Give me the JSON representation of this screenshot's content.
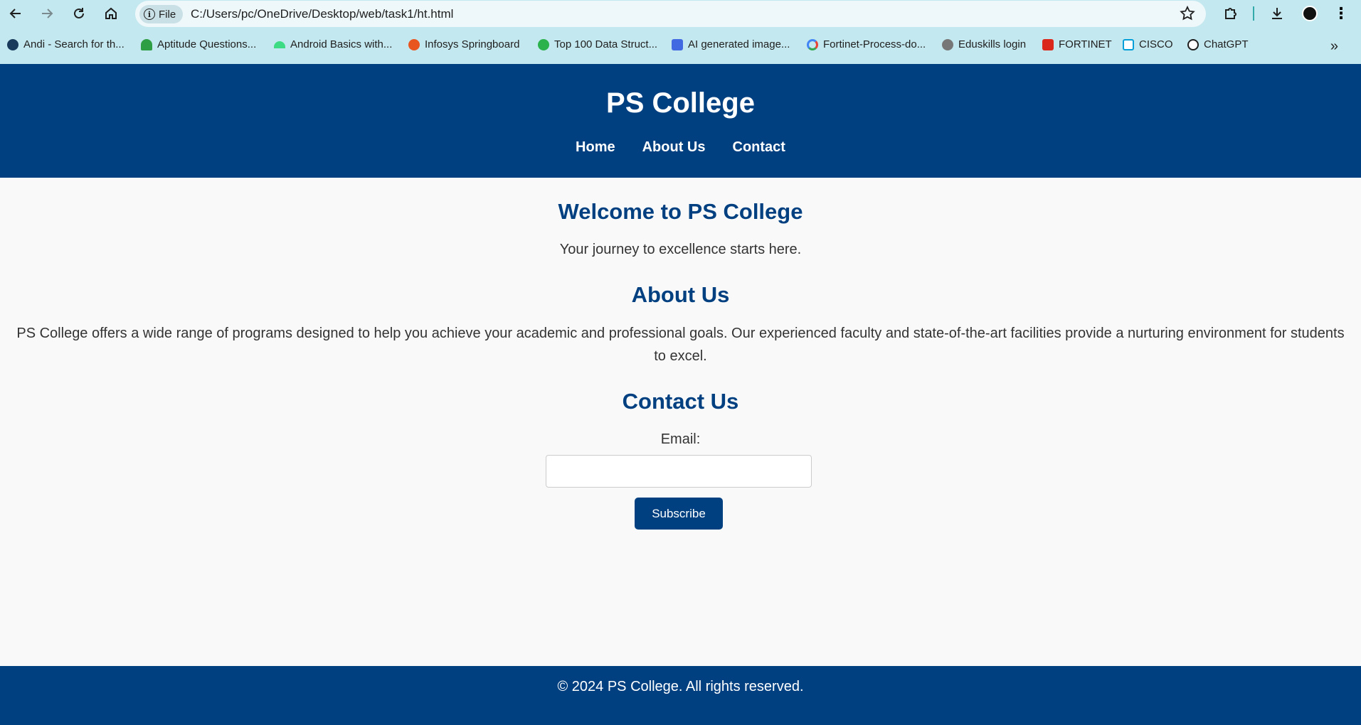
{
  "browser": {
    "file_chip_label": "File",
    "url": "C:/Users/pc/OneDrive/Desktop/web/task1/ht.html",
    "bookmarks": [
      {
        "label": "Andi - Search for th...",
        "icon": "andi-icon",
        "color": "#1a3a5c"
      },
      {
        "label": "Aptitude Questions...",
        "icon": "umbrella-icon",
        "color": "#2e9e45"
      },
      {
        "label": "Android Basics with...",
        "icon": "android-icon",
        "color": "#3ddc84"
      },
      {
        "label": "Infosys Springboard",
        "icon": "infosys-icon",
        "color": "#e8551f"
      },
      {
        "label": "Top 100 Data Struct...",
        "icon": "play-badge-icon",
        "color": "#2bb24c"
      },
      {
        "label": "AI generated image...",
        "icon": "f-logo-icon",
        "color": "#4169e1"
      },
      {
        "label": "Fortinet-Process-do...",
        "icon": "google-icon",
        "color": "#4285f4"
      },
      {
        "label": "Eduskills login",
        "icon": "eduskills-icon",
        "color": "#777777"
      },
      {
        "label": "FORTINET",
        "icon": "fortinet-icon",
        "color": "#da291c"
      },
      {
        "label": "CISCO",
        "icon": "cisco-icon",
        "color": "#049fd9"
      },
      {
        "label": "ChatGPT",
        "icon": "chatgpt-icon",
        "color": "#1f1f1f"
      }
    ]
  },
  "site": {
    "title": "PS College",
    "nav": [
      "Home",
      "About Us",
      "Contact"
    ],
    "welcome": {
      "heading": "Welcome to PS College",
      "text": "Your journey to excellence starts here."
    },
    "about": {
      "heading": "About Us",
      "text": "PS College offers a wide range of programs designed to help you achieve your academic and professional goals. Our experienced faculty and state-of-the-art facilities provide a nurturing environment for students to excel."
    },
    "contact": {
      "heading": "Contact Us",
      "email_label": "Email:",
      "email_value": "",
      "button_label": "Subscribe"
    },
    "footer": "© 2024 PS College. All rights reserved."
  },
  "colors": {
    "primary": "#004080",
    "chrome": "#c4e8ef",
    "page_bg": "#f9f9f9"
  }
}
